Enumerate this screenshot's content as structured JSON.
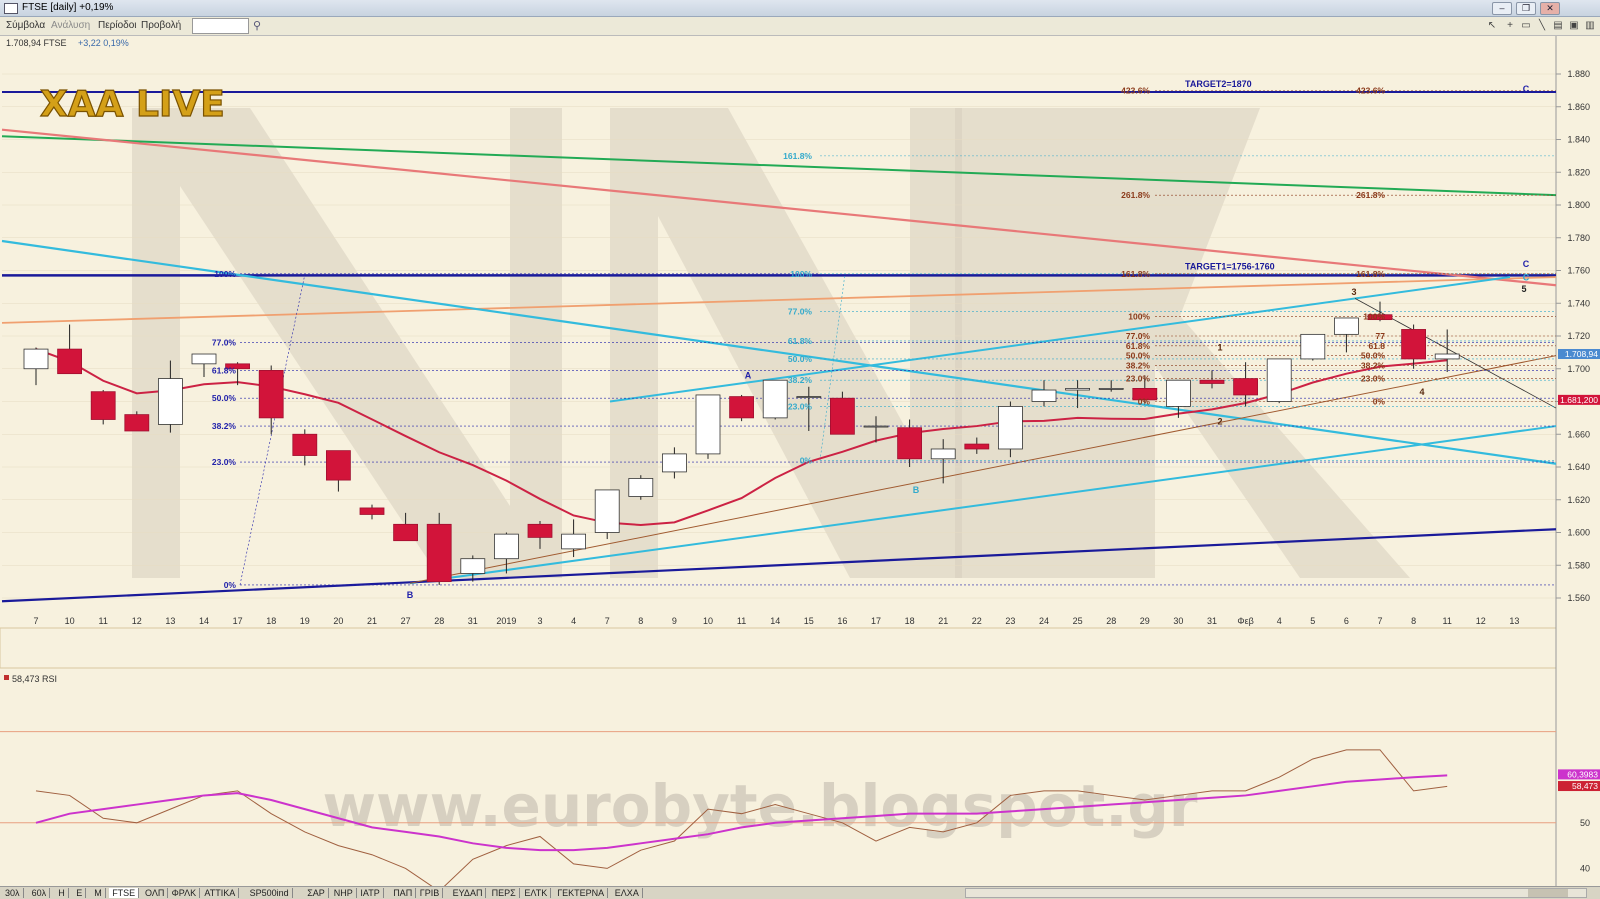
{
  "window": {
    "title": "FTSE [daily] +0,19%"
  },
  "menu": [
    {
      "id": "symbols",
      "label": "Σύμβολα"
    },
    {
      "id": "analysis",
      "label": "Ανάλυση"
    },
    {
      "id": "period",
      "label": "Περίοδοι"
    },
    {
      "id": "view",
      "label": "Προβολή"
    }
  ],
  "header": {
    "price_line": "1.708,94 FTSE",
    "change": "+3,22 0,19%"
  },
  "watermarks": {
    "logo": "XAA LIVE",
    "url": "www.eurobyte.blogspot.gr",
    "big_letters": "NK"
  },
  "colors": {
    "bull_body": "#ffffff",
    "bear_body": "#d2143a",
    "ma": "#cc2244",
    "green_line": "#22aa55",
    "pink_line": "#e87878",
    "orange_line": "#f0a070",
    "cyan": "#33bbdd",
    "navy": "#1a1a9a",
    "rsi": "#cc33cc",
    "rsi_raw": "#a06040",
    "fib_blue": "#2222aa",
    "fib_cyan": "#33aacc",
    "fib_brown": "#8b3a1a"
  },
  "tabs": [
    "30λ",
    "60λ",
    "Η",
    "Ε",
    "Μ",
    "FTSE",
    "ΟΛΠ",
    "ΦΡΛΚ",
    "ΑΤΤΙΚΑ",
    "SP500ind",
    "ΣΑΡ",
    "ΝΗΡ",
    "ΙΑΤΡ",
    "ΠΑΠ",
    "ΓΡΙΒ",
    "ΕΥΔΑΠ",
    "ΠΕΡΣ",
    "ΕΛΤΚ",
    "ΓΕΚΤΕΡΝΑ",
    "ΕΛΧΑ"
  ],
  "chart_data": [
    {
      "type": "candlestick",
      "title": "FTSE [daily]",
      "ylim": [
        1548,
        1888
      ],
      "y_ticks": [
        "1.880",
        "1.860",
        "1.840",
        "1.820",
        "1.800",
        "1.780",
        "1.760",
        "1.740",
        "1.720",
        "1.700",
        "1.680",
        "1.660",
        "1.640",
        "1.620",
        "1.600",
        "1.580",
        "1.560"
      ],
      "x_labels": [
        "7",
        "10",
        "11",
        "12",
        "13",
        "14",
        "17",
        "18",
        "19",
        "20",
        "21",
        "27",
        "28",
        "31",
        "2019",
        "3",
        "4",
        "7",
        "8",
        "9",
        "10",
        "11",
        "14",
        "15",
        "16",
        "17",
        "18",
        "21",
        "22",
        "23",
        "24",
        "25",
        "28",
        "29",
        "30",
        "31",
        "Φεβ",
        "4",
        "5",
        "6",
        "7",
        "8",
        "11",
        "12",
        "13"
      ],
      "candles": [
        {
          "o": 1700,
          "h": 1713,
          "l": 1690,
          "c": 1712
        },
        {
          "o": 1712,
          "h": 1727,
          "l": 1697,
          "c": 1697
        },
        {
          "o": 1686,
          "h": 1687,
          "l": 1666,
          "c": 1669
        },
        {
          "o": 1672,
          "h": 1674,
          "l": 1662,
          "c": 1662
        },
        {
          "o": 1666,
          "h": 1705,
          "l": 1661,
          "c": 1694
        },
        {
          "o": 1703,
          "h": 1709,
          "l": 1695,
          "c": 1709
        },
        {
          "o": 1703,
          "h": 1704,
          "l": 1690,
          "c": 1700
        },
        {
          "o": 1699,
          "h": 1702,
          "l": 1660,
          "c": 1670
        },
        {
          "o": 1660,
          "h": 1663,
          "l": 1641,
          "c": 1647
        },
        {
          "o": 1650,
          "h": 1650,
          "l": 1625,
          "c": 1632
        },
        {
          "o": 1615,
          "h": 1617,
          "l": 1608,
          "c": 1611
        },
        {
          "o": 1605,
          "h": 1612,
          "l": 1598,
          "c": 1595
        },
        {
          "o": 1605,
          "h": 1612,
          "l": 1568,
          "c": 1570
        },
        {
          "o": 1575,
          "h": 1586,
          "l": 1570,
          "c": 1584
        },
        {
          "o": 1584,
          "h": 1600,
          "l": 1575,
          "c": 1599
        },
        {
          "o": 1605,
          "h": 1607,
          "l": 1590,
          "c": 1597
        },
        {
          "o": 1590,
          "h": 1608,
          "l": 1585,
          "c": 1599
        },
        {
          "o": 1600,
          "h": 1626,
          "l": 1596,
          "c": 1626
        },
        {
          "o": 1622,
          "h": 1635,
          "l": 1620,
          "c": 1633
        },
        {
          "o": 1637,
          "h": 1652,
          "l": 1633,
          "c": 1648
        },
        {
          "o": 1648,
          "h": 1684,
          "l": 1645,
          "c": 1684
        },
        {
          "o": 1683,
          "h": 1684,
          "l": 1668,
          "c": 1670
        },
        {
          "o": 1670,
          "h": 1691,
          "l": 1669,
          "c": 1693
        },
        {
          "o": 1683,
          "h": 1689,
          "l": 1662,
          "c": 1683
        },
        {
          "o": 1682,
          "h": 1686,
          "l": 1660,
          "c": 1660
        },
        {
          "o": 1665,
          "h": 1671,
          "l": 1655,
          "c": 1665
        },
        {
          "o": 1664,
          "h": 1669,
          "l": 1640,
          "c": 1645
        },
        {
          "o": 1645,
          "h": 1657,
          "l": 1630,
          "c": 1651
        },
        {
          "o": 1654,
          "h": 1658,
          "l": 1648,
          "c": 1651
        },
        {
          "o": 1651,
          "h": 1680,
          "l": 1646,
          "c": 1677
        },
        {
          "o": 1680,
          "h": 1693,
          "l": 1677,
          "c": 1687
        },
        {
          "o": 1687,
          "h": 1693,
          "l": 1676,
          "c": 1688
        },
        {
          "o": 1688,
          "h": 1693,
          "l": 1686,
          "c": 1688
        },
        {
          "o": 1688,
          "h": 1696,
          "l": 1679,
          "c": 1681
        },
        {
          "o": 1677,
          "h": 1693,
          "l": 1670,
          "c": 1693
        },
        {
          "o": 1693,
          "h": 1699,
          "l": 1688,
          "c": 1691
        },
        {
          "o": 1694,
          "h": 1704,
          "l": 1677,
          "c": 1684
        },
        {
          "o": 1680,
          "h": 1705,
          "l": 1679,
          "c": 1706
        },
        {
          "o": 1706,
          "h": 1721,
          "l": 1705,
          "c": 1721
        },
        {
          "o": 1721,
          "h": 1731,
          "l": 1710,
          "c": 1731
        },
        {
          "o": 1733,
          "h": 1741,
          "l": 1729,
          "c": 1730
        },
        {
          "o": 1724,
          "h": 1727,
          "l": 1700,
          "c": 1706
        },
        {
          "o": 1706,
          "h": 1724,
          "l": 1698,
          "c": 1709
        }
      ],
      "price_label": "1.708,94",
      "ma_label": "1.681,200",
      "fib_left": [
        "100%",
        "77.0%",
        "61.8%",
        "50.0%",
        "38.2%",
        "23.0%",
        "0%"
      ],
      "fib_mid": [
        "161.8%",
        "100%",
        "77.0%",
        "61.8%",
        "50.0%",
        "38.2%",
        "23.0%",
        "0%"
      ],
      "fib_right": [
        "423.6%",
        "261.8%",
        "161.8%",
        "100%",
        "77.0%",
        "61.8%",
        "50.0%",
        "38.2%",
        "23.0%",
        "0%"
      ],
      "fib_right2": [
        "423.6%",
        "261.8%",
        "161.8%",
        "100%",
        "77",
        "61.8",
        "50.0%",
        "38.2%",
        "23.0%",
        "0%"
      ],
      "targets": [
        "TARGET2=1870",
        "TARGET1=1756-1760"
      ],
      "wave_labels": [
        "A",
        "B",
        "B",
        "C",
        "C",
        "C",
        "1",
        "2",
        "3",
        "4",
        "5"
      ]
    },
    {
      "type": "line",
      "title": "58,473 RSI",
      "ylim": [
        30,
        80
      ],
      "y_ticks": [
        "50",
        "40"
      ],
      "series": [
        {
          "name": "RSI",
          "last": "58,473"
        },
        {
          "name": "",
          "last": "60,3983"
        }
      ]
    }
  ]
}
